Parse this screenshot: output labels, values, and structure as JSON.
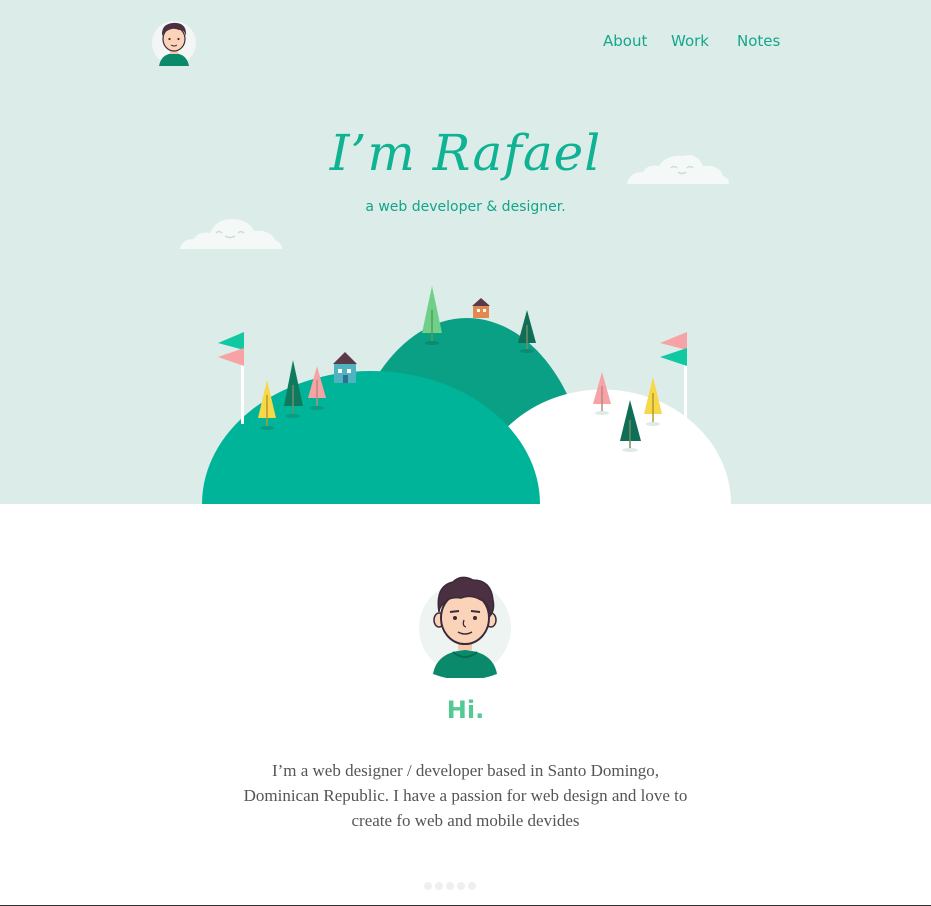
{
  "nav": {
    "items": [
      {
        "label": "About"
      },
      {
        "label": "Work"
      },
      {
        "label": "Notes"
      }
    ]
  },
  "hero": {
    "title": "I’m Rafael",
    "subtitle": "a web developer & designer."
  },
  "about": {
    "greeting": "Hi.",
    "bio": "I’m a web designer / developer based in Santo Domingo, Dominican Republic. I have a passion for web design and love to create fo web and mobile devides"
  },
  "pager": {
    "count": 5,
    "active_index": 0
  },
  "colors": {
    "hero_bg": "#dcede9",
    "accent_teal": "#10b294",
    "dark_green": "#0f7a5e",
    "hill_dark": "#0aa085",
    "hill_light": "#00b499",
    "greeting_green": "#55c994",
    "text_gray": "#555555",
    "flag_pink": "#f7a3a6",
    "tree_yellow": "#f6d84a"
  },
  "icons": {
    "logo": "avatar-icon",
    "cloud": "cloud-icon",
    "flag": "flag-icon",
    "tree": "tree-icon",
    "house": "house-icon"
  }
}
